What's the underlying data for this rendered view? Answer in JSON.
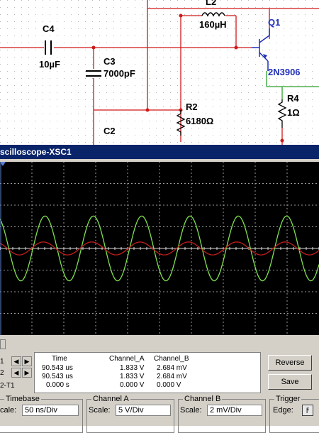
{
  "schematic": {
    "components": {
      "c4_name": "C4",
      "c4_value": "10µF",
      "c3_name": "C3",
      "c3_value": "7000pF",
      "l2_name": "L2",
      "l2_value": "160µH",
      "q1_name": "Q1",
      "q1_value": "2N3906",
      "r2_name": "R2",
      "r2_value": "6180Ω",
      "r4_name": "R4",
      "r4_value": "1Ω",
      "c2_name": "C2"
    }
  },
  "scope": {
    "title": "scilloscope-XSC1",
    "readout": {
      "headers": {
        "time": "Time",
        "channel_a": "Channel_A",
        "channel_b": "Channel_B"
      },
      "rows": [
        {
          "label": "1",
          "time": "90.543 us",
          "a": "1.833 V",
          "b": "2.684 mV"
        },
        {
          "label": "2",
          "time": "90.543 us",
          "a": "1.833 V",
          "b": "2.684 mV"
        },
        {
          "label": "2-T1",
          "time": "0.000 s",
          "a": "0.000 V",
          "b": "0.000 V"
        }
      ]
    },
    "buttons": {
      "reverse": "Reverse",
      "save": "Save"
    },
    "timebase": {
      "title": "Timebase",
      "scale_label": "cale:",
      "scale_value": "50 ns/Div"
    },
    "channel_a": {
      "title": "Channel A",
      "scale_label": "Scale:",
      "scale_value": "5  V/Div"
    },
    "channel_b": {
      "title": "Channel B",
      "scale_label": "Scale:",
      "scale_value": "2 mV/Div"
    },
    "trigger": {
      "title": "Trigger",
      "edge_label": "Edge:"
    },
    "colors": {
      "channel_a_trace": "#7fe04f",
      "channel_b_trace": "#c41e1e",
      "screen": "#000000",
      "titlebar": "#0a246a"
    }
  },
  "chart_data": {
    "type": "line",
    "grid": true,
    "x_divisions": 10,
    "y_divisions": 8,
    "series": [
      {
        "name": "Channel_A",
        "color": "#7fe04f",
        "cycles": 6.6,
        "amplitude_div": 1.5,
        "phase": 2.0
      },
      {
        "name": "Channel_B",
        "color": "#c41e1e",
        "cycles": 6.6,
        "amplitude_div": 0.3,
        "phase": 2.2
      }
    ]
  }
}
